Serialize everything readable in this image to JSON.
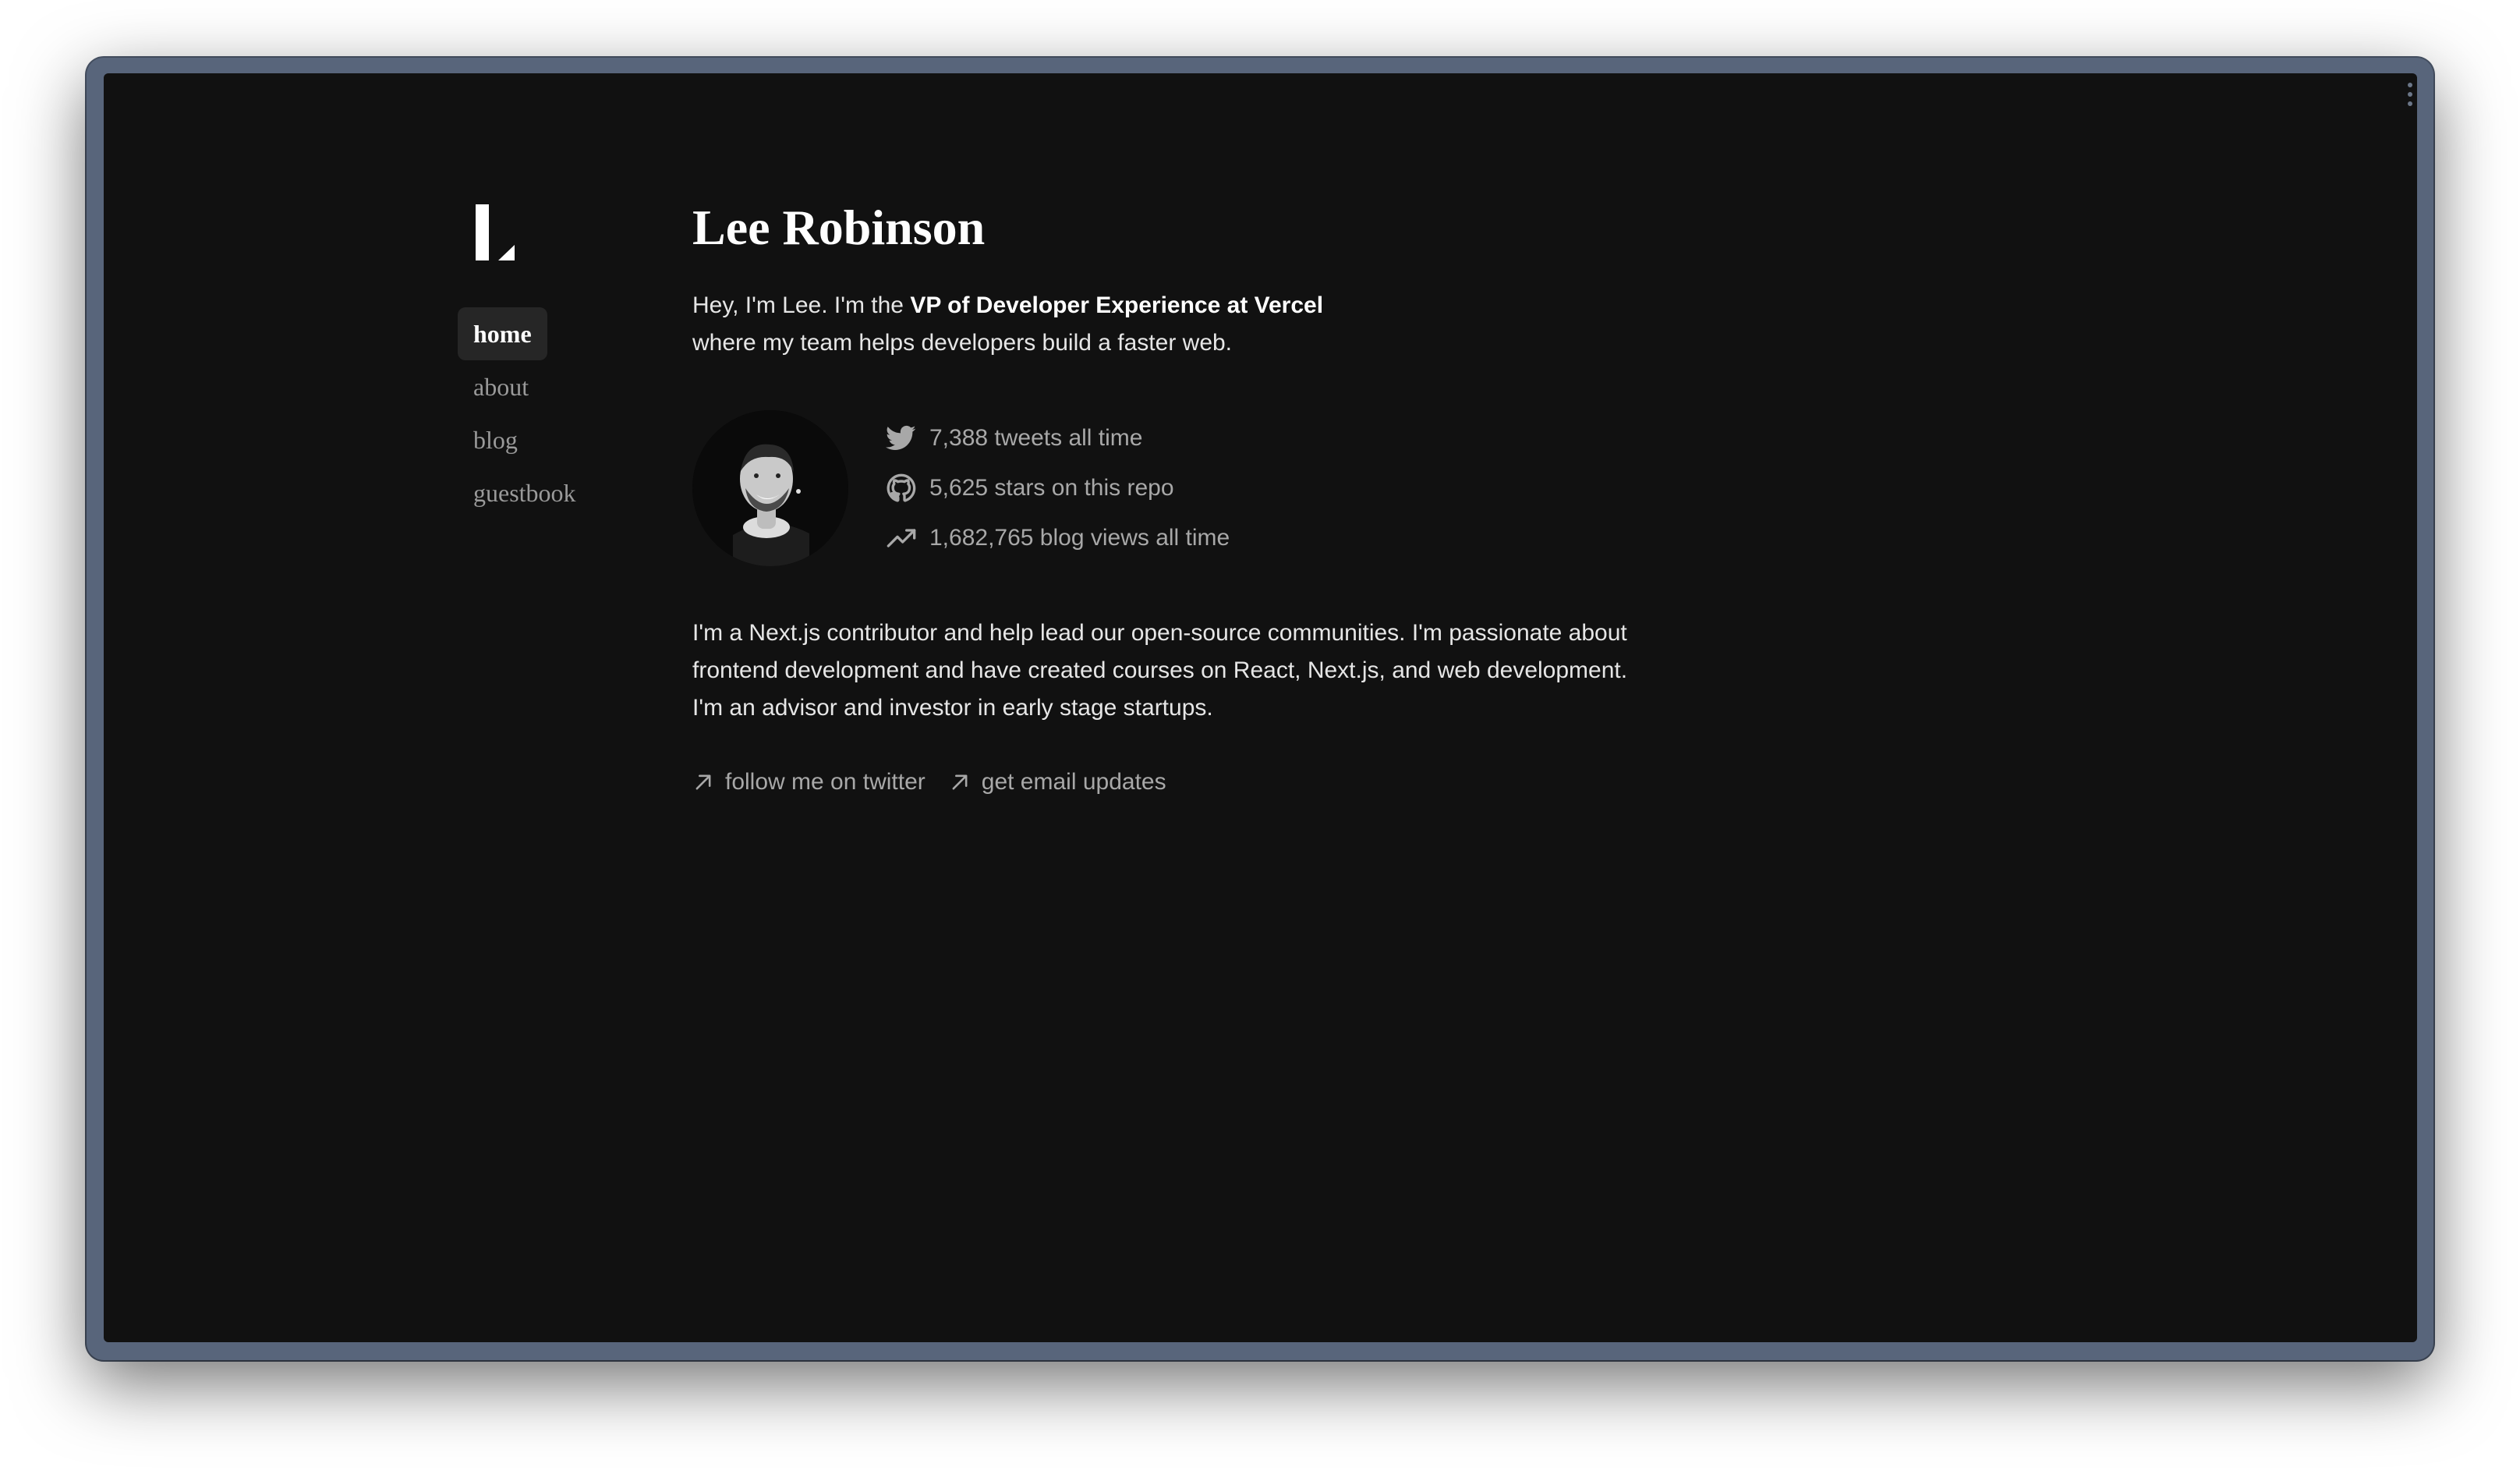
{
  "nav": {
    "items": [
      {
        "label": "home",
        "active": true
      },
      {
        "label": "about",
        "active": false
      },
      {
        "label": "blog",
        "active": false
      },
      {
        "label": "guestbook",
        "active": false
      }
    ]
  },
  "header": {
    "title": "Lee Robinson"
  },
  "intro": {
    "prefix": "Hey, I'm Lee. I'm the ",
    "bold": "VP of Developer Experience at Vercel",
    "suffix": "where my team helps developers build a faster web."
  },
  "stats": [
    {
      "icon": "twitter-icon",
      "text": "7,388 tweets all time"
    },
    {
      "icon": "github-icon",
      "text": "5,625 stars on this repo"
    },
    {
      "icon": "trending-up-icon",
      "text": "1,682,765 blog views all time"
    }
  ],
  "bio": "I'm a Next.js contributor and help lead our open-source communities. I'm passionate about frontend development and have created courses on React, Next.js, and web development. I'm an advisor and investor in early stage startups.",
  "links": [
    {
      "icon": "arrow-up-right-icon",
      "label": "follow me on twitter"
    },
    {
      "icon": "arrow-up-right-icon",
      "label": "get email updates"
    }
  ],
  "colors": {
    "background": "#111111",
    "frame": "#58657b",
    "text_primary": "#ffffff",
    "text_muted": "#9a9a9a",
    "nav_active_bg": "#262626"
  }
}
